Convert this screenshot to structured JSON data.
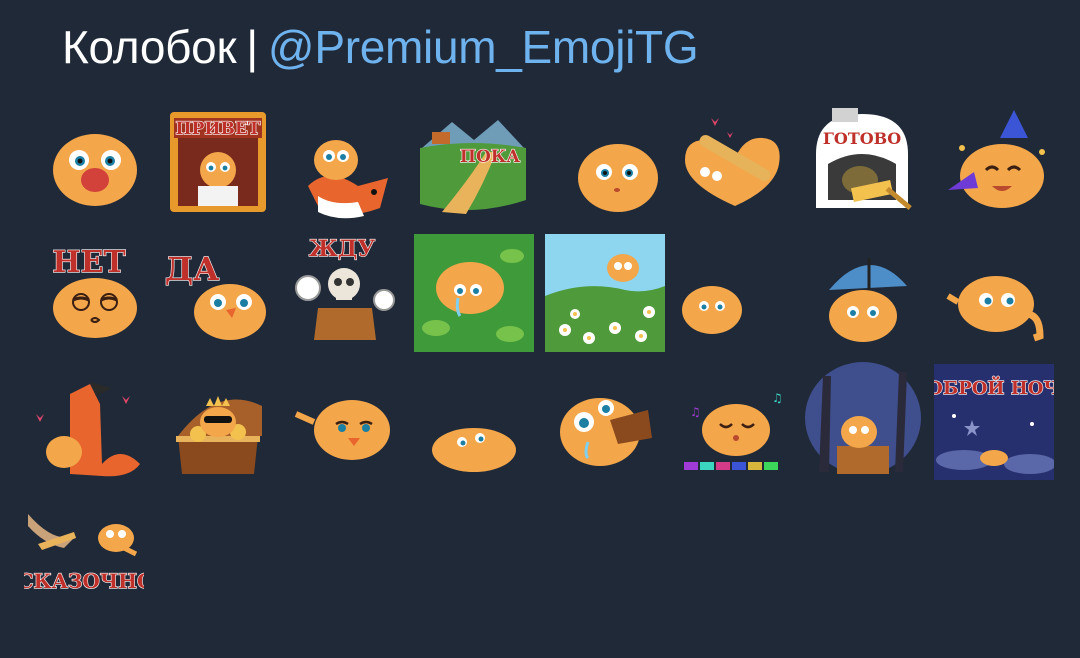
{
  "header": {
    "pack_name": "Колобок",
    "separator": "|",
    "channel_handle": "@Premium_EmojiTG"
  },
  "colors": {
    "background": "#202938",
    "title_text": "#ffffff",
    "handle_link": "#6eb2ee",
    "kolobok_body": "#f3a64a"
  },
  "stickers": [
    {
      "id": "face-big-nose",
      "caption": ""
    },
    {
      "id": "window-greeting",
      "caption": "ПРИВЕТ"
    },
    {
      "id": "fox-carry",
      "caption": ""
    },
    {
      "id": "road-goodbye",
      "caption": "ПОКА"
    },
    {
      "id": "plain-face",
      "caption": ""
    },
    {
      "id": "rolling-pin-heart",
      "caption": ""
    },
    {
      "id": "oven-done",
      "caption": "ГОТОВО"
    },
    {
      "id": "party-horn",
      "caption": ""
    },
    {
      "id": "no-glasses",
      "caption": "НЕТ"
    },
    {
      "id": "yes-duck",
      "caption": "ДА"
    },
    {
      "id": "wait-skeleton",
      "caption": "ЖДУ"
    },
    {
      "id": "lily-pond-crying",
      "caption": ""
    },
    {
      "id": "daisy-meadow",
      "caption": ""
    },
    {
      "id": "small-blob",
      "caption": ""
    },
    {
      "id": "umbrella-sad",
      "caption": ""
    },
    {
      "id": "side-eye-wave",
      "caption": ""
    },
    {
      "id": "fox-love",
      "caption": ""
    },
    {
      "id": "treasure-chest",
      "caption": ""
    },
    {
      "id": "duck-lips-point",
      "caption": ""
    },
    {
      "id": "flat-lying",
      "caption": ""
    },
    {
      "id": "drinking-cup",
      "caption": ""
    },
    {
      "id": "dance-floor",
      "caption": ""
    },
    {
      "id": "night-forest-stump",
      "caption": ""
    },
    {
      "id": "good-night",
      "caption": "ДОБРОЙ НОЧИ"
    },
    {
      "id": "magic-flying",
      "caption": "СКАЗОЧНО"
    }
  ]
}
